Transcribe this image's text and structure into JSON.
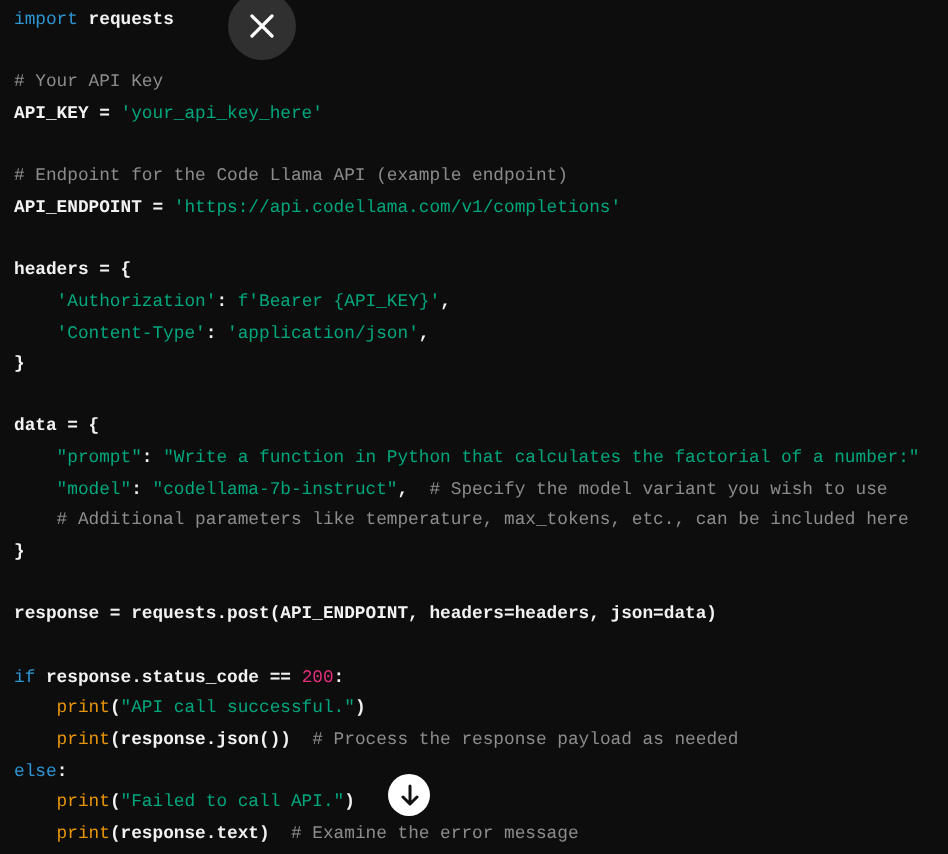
{
  "code_blocks": [
    [
      [
        {
          "text": "import",
          "kind": "keyword"
        },
        {
          "text": " requests",
          "kind": "plain"
        }
      ]
    ],
    [
      [
        {
          "text": "# Your API Key",
          "kind": "comment"
        }
      ],
      [
        {
          "text": "API_KEY = ",
          "kind": "plain"
        },
        {
          "text": "'your_api_key_here'",
          "kind": "string"
        }
      ]
    ],
    [
      [
        {
          "text": "# Endpoint for the Code Llama API (example endpoint)",
          "kind": "comment"
        }
      ],
      [
        {
          "text": "API_ENDPOINT = ",
          "kind": "plain"
        },
        {
          "text": "'https://api.codellama.com/v1/completions'",
          "kind": "string"
        }
      ]
    ],
    [
      [
        {
          "text": "headers = {",
          "kind": "plain"
        }
      ],
      [
        {
          "text": "    'Authorization'",
          "kind": "string"
        },
        {
          "text": ": ",
          "kind": "plain"
        },
        {
          "text": "f'Bearer {API_KEY}'",
          "kind": "string"
        },
        {
          "text": ",",
          "kind": "plain"
        }
      ],
      [
        {
          "text": "    'Content-Type'",
          "kind": "string"
        },
        {
          "text": ": ",
          "kind": "plain"
        },
        {
          "text": "'application/json'",
          "kind": "string"
        },
        {
          "text": ",",
          "kind": "plain"
        }
      ],
      [
        {
          "text": "}",
          "kind": "plain"
        }
      ]
    ],
    [
      [
        {
          "text": "data = {",
          "kind": "plain"
        }
      ],
      [
        {
          "text": "    \"prompt\"",
          "kind": "string"
        },
        {
          "text": ": ",
          "kind": "plain"
        },
        {
          "text": "\"Write a function in Python that calculates the factorial of a number:\"",
          "kind": "string"
        }
      ],
      [
        {
          "text": "    \"model\"",
          "kind": "string"
        },
        {
          "text": ": ",
          "kind": "plain"
        },
        {
          "text": "\"codellama-7b-instruct\"",
          "kind": "string"
        },
        {
          "text": ",  ",
          "kind": "plain"
        },
        {
          "text": "# Specify the model variant you wish to use",
          "kind": "comment"
        }
      ],
      [
        {
          "text": "    # Additional parameters like temperature, max_tokens, etc., can be included here",
          "kind": "comment"
        }
      ],
      [
        {
          "text": "}",
          "kind": "plain"
        }
      ]
    ],
    [
      [
        {
          "text": "response = requests.post(API_ENDPOINT, headers=headers, json=data)",
          "kind": "plain"
        }
      ]
    ],
    [
      [
        {
          "text": "if",
          "kind": "keyword"
        },
        {
          "text": " response.status_code == ",
          "kind": "plain"
        },
        {
          "text": "200",
          "kind": "number"
        },
        {
          "text": ":",
          "kind": "plain"
        }
      ],
      [
        {
          "text": "    print",
          "kind": "builtin"
        },
        {
          "text": "(",
          "kind": "plain"
        },
        {
          "text": "\"API call successful.\"",
          "kind": "string"
        },
        {
          "text": ")",
          "kind": "plain"
        }
      ],
      [
        {
          "text": "    print",
          "kind": "builtin"
        },
        {
          "text": "(response.json())  ",
          "kind": "plain"
        },
        {
          "text": "# Process the response payload as needed",
          "kind": "comment"
        }
      ],
      [
        {
          "text": "else",
          "kind": "keyword"
        },
        {
          "text": ":",
          "kind": "plain"
        }
      ],
      [
        {
          "text": "    print",
          "kind": "builtin"
        },
        {
          "text": "(",
          "kind": "plain"
        },
        {
          "text": "\"Failed to call API.\"",
          "kind": "string"
        },
        {
          "text": ")",
          "kind": "plain"
        }
      ],
      [
        {
          "text": "    print",
          "kind": "builtin"
        },
        {
          "text": "(response.text)  ",
          "kind": "plain"
        },
        {
          "text": "# Examine the error message",
          "kind": "comment"
        }
      ]
    ]
  ]
}
